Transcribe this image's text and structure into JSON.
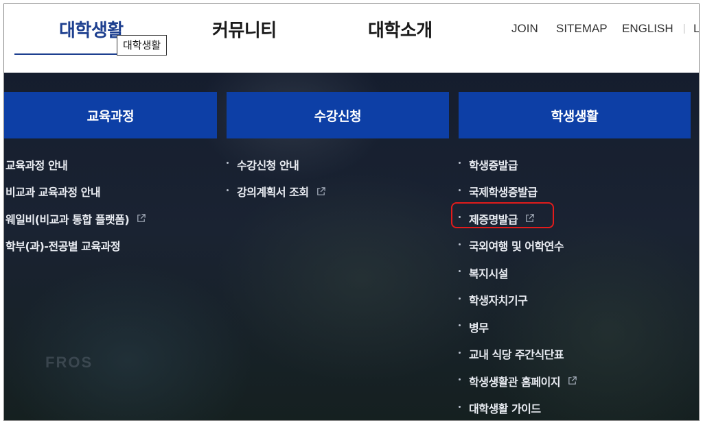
{
  "nav": {
    "items": [
      {
        "label": "대학생활",
        "active": true
      },
      {
        "label": "커뮤니티",
        "active": false
      },
      {
        "label": "대학소개",
        "active": false
      }
    ],
    "tooltip": "대학생활",
    "util": [
      "JOIN",
      "SITEMAP",
      "ENGLISH"
    ],
    "util_cut": "L"
  },
  "mega": {
    "watermark": "FROS",
    "columns": [
      {
        "title": "교육과정",
        "items": [
          {
            "label": "교육과정 안내",
            "external": false
          },
          {
            "label": "비교과 교육과정 안내",
            "external": false
          },
          {
            "label": "웨일비(비교과 통합 플랫폼)",
            "external": true
          },
          {
            "label": "학부(과)-전공별 교육과정",
            "external": false
          }
        ]
      },
      {
        "title": "수강신청",
        "items": [
          {
            "label": "수강신청 안내",
            "external": false
          },
          {
            "label": "강의계획서 조회",
            "external": true
          }
        ]
      },
      {
        "title": "학생생활",
        "items": [
          {
            "label": "학생증발급",
            "external": false
          },
          {
            "label": "국제학생증발급",
            "external": false
          },
          {
            "label": "제증명발급",
            "external": true,
            "highlighted": true
          },
          {
            "label": "국외여행 및 어학연수",
            "external": false
          },
          {
            "label": "복지시설",
            "external": false
          },
          {
            "label": "학생자치기구",
            "external": false
          },
          {
            "label": "병무",
            "external": false
          },
          {
            "label": "교내 식당 주간식단표",
            "external": false
          },
          {
            "label": "학생생활관 홈페이지",
            "external": true
          },
          {
            "label": "대학생활 가이드",
            "external": false
          }
        ]
      }
    ]
  },
  "colors": {
    "header_blue": "#0d3fa6",
    "active_nav": "#1d3f8f",
    "highlight_red": "#e31b1b"
  }
}
